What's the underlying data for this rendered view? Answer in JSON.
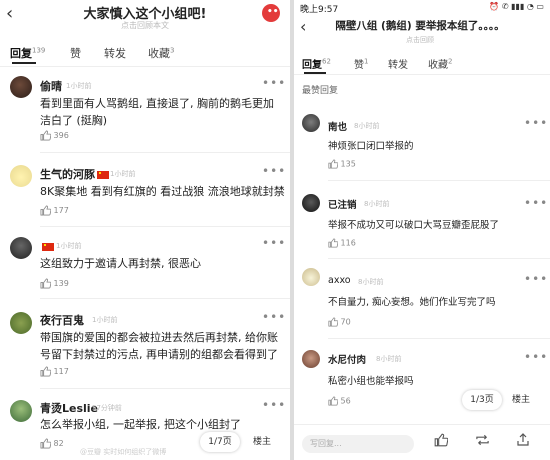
{
  "left": {
    "back_glyph": "‹",
    "title": "大家慎入这个小组吧!",
    "subtitle": "点击回顾本文",
    "notif_dots": "•••",
    "tabs": [
      {
        "label": "回复",
        "count": "139"
      },
      {
        "label": "赞",
        "count": ""
      },
      {
        "label": "转发",
        "count": ""
      },
      {
        "label": "收藏",
        "count": "3"
      }
    ],
    "posts": [
      {
        "user": "偷晴",
        "time": "1小时前",
        "text": "看到里面有人骂鹅组, 直接退了, 胸前的鹅毛更加洁白了 (挺胸)",
        "likes": "396",
        "flag": false
      },
      {
        "user": "生气的河豚",
        "time": "1小时前",
        "text": "8K聚集地 看到有红旗的 看过战狼 流浪地球就封禁",
        "likes": "177",
        "flag": true
      },
      {
        "user": "",
        "time": "1小时前",
        "text": "这组致力于邀请人再封禁, 很恶心",
        "likes": "139",
        "flag": true
      },
      {
        "user": "夜行百鬼",
        "time": "1小时前",
        "text": "带国旗的爱国的都会被拉进去然后再封禁, 给你账号留下封禁过的污点, 再申请别的组都会看得到了",
        "likes": "117",
        "flag": false
      },
      {
        "user": "青烫Leslie",
        "time": "57分钟前",
        "text": "怎么举报小组, 一起举报, 把这个小组封了",
        "likes": "82",
        "flag": false
      }
    ],
    "pager": "1/7页",
    "pager_right": "楼主",
    "watermark": "@豆瓣 实时如何组织了微博"
  },
  "right": {
    "time": "晚上9:57",
    "status_icons": "⏰ ✆ ▮▮▮ ◔ ▭",
    "back_glyph": "‹",
    "title": "隔壁八组 (鹅组) 要举报本组了。。。。",
    "subtitle": "点击回顾",
    "tabs": [
      {
        "label": "回复",
        "count": "62"
      },
      {
        "label": "赞",
        "count": "1"
      },
      {
        "label": "转发",
        "count": ""
      },
      {
        "label": "收藏",
        "count": "2"
      }
    ],
    "section": "最赞回复",
    "posts": [
      {
        "user": "南也",
        "time": "8小时前",
        "text": "神烦张口闭口举报的",
        "likes": "135"
      },
      {
        "user": "已注销",
        "time": "8小时前",
        "text": "举报不成功又可以破口大骂豆瓣歪屁股了",
        "likes": "116"
      },
      {
        "user": "axxo",
        "time": "8小时前",
        "text": "不自量力, 痴心妄想。她们作业写完了吗",
        "likes": "70"
      },
      {
        "user": "水尼付肉",
        "time": "8小时前",
        "text": "私密小组也能举报吗",
        "likes": "56"
      }
    ],
    "pager": "1/3页",
    "pager_right": "楼主",
    "reply_placeholder": "写回复..."
  },
  "colors": {
    "accent_red": "#e33b3b",
    "flag_red": "#de2910",
    "flag_yellow": "#ffde00"
  }
}
